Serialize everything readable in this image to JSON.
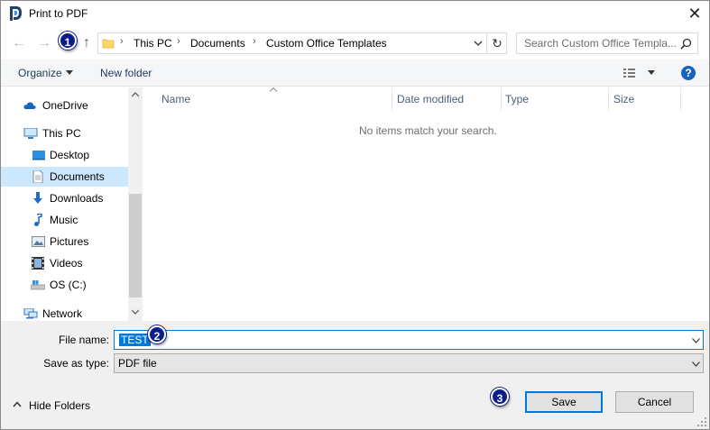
{
  "window": {
    "title": "Print to PDF",
    "close_glyph": "✕"
  },
  "nav": {
    "back_glyph": "←",
    "forward_glyph": "→",
    "up_glyph": "↑",
    "refresh_glyph": "↻"
  },
  "address": {
    "crumbs": [
      "This PC",
      "Documents",
      "Custom Office Templates"
    ],
    "sep": "›"
  },
  "search": {
    "placeholder": "Search Custom Office Templa..."
  },
  "toolbar": {
    "organize": "Organize",
    "new_folder": "New folder",
    "help": "?"
  },
  "sidebar": {
    "items": [
      {
        "label": "OneDrive",
        "icon": "cloud-icon"
      },
      {
        "label": "This PC",
        "icon": "computer-icon"
      },
      {
        "label": "Desktop",
        "icon": "desktop-icon"
      },
      {
        "label": "Documents",
        "icon": "documents-icon",
        "selected": true
      },
      {
        "label": "Downloads",
        "icon": "download-icon"
      },
      {
        "label": "Music",
        "icon": "music-icon"
      },
      {
        "label": "Pictures",
        "icon": "pictures-icon"
      },
      {
        "label": "Videos",
        "icon": "videos-icon"
      },
      {
        "label": "OS (C:)",
        "icon": "drive-icon"
      },
      {
        "label": "Network",
        "icon": "network-icon"
      }
    ]
  },
  "file_list": {
    "columns": [
      "Name",
      "Date modified",
      "Type",
      "Size"
    ],
    "empty_message": "No items match your search."
  },
  "form": {
    "file_name_label": "File name:",
    "file_name_value": "TEST",
    "save_as_type_label": "Save as type:",
    "save_as_type_value": "PDF file"
  },
  "footer": {
    "hide_folders": "Hide Folders",
    "save": "Save",
    "cancel": "Cancel"
  },
  "callouts": [
    "1",
    "2",
    "3"
  ],
  "colors": {
    "accent": "#0078d7",
    "selection": "#cce8ff",
    "callout": "#0b1d8a"
  }
}
